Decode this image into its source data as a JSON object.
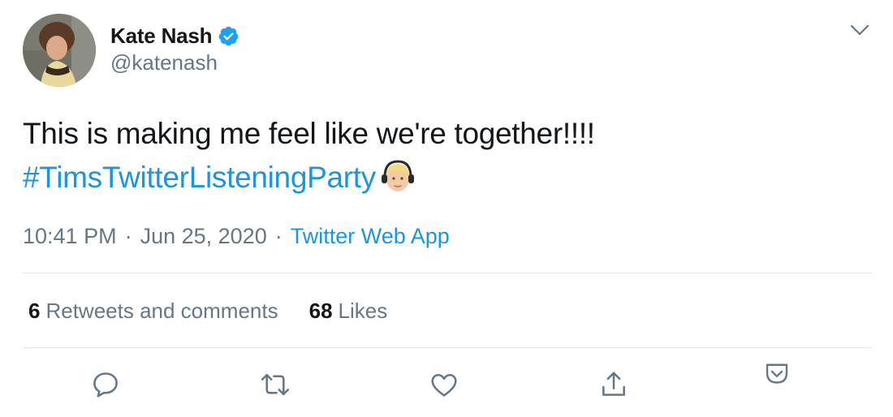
{
  "tweet": {
    "author": {
      "display_name": "Kate Nash",
      "handle": "@katenash",
      "verified": true,
      "avatar_icon": "profile-photo"
    },
    "text_line_1": "This is making me feel like we're together!!!!",
    "hashtag": "#TimsTwitterListeningParty",
    "emoji_icon": "blond-face-with-headphones",
    "timestamp": "10:41 PM",
    "separator": "·",
    "date": "Jun 25, 2020",
    "source": "Twitter Web App",
    "stats": {
      "retweets_count": "6",
      "retweets_label": "Retweets and comments",
      "likes_count": "68",
      "likes_label": "Likes"
    },
    "actions": [
      "reply-icon",
      "retweet-icon",
      "like-icon",
      "share-icon",
      "save-to-pocket-icon"
    ]
  },
  "colors": {
    "text": "#14171a",
    "secondary": "#657786",
    "link": "#1b95e0",
    "verified": "#1da1f2",
    "divider": "#e1e8ed"
  }
}
